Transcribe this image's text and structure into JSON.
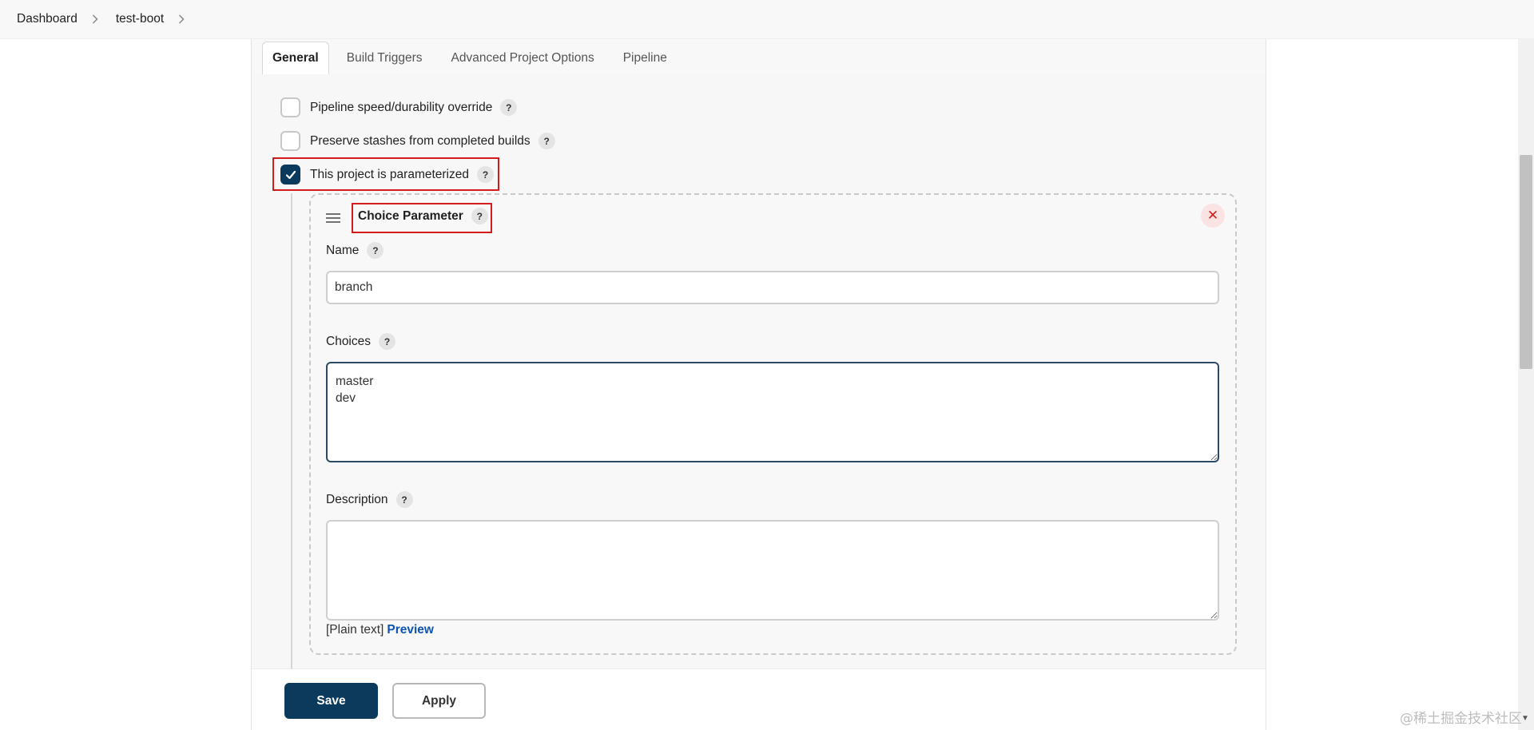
{
  "breadcrumb": {
    "items": [
      "Dashboard",
      "test-boot"
    ]
  },
  "tabs": [
    "General",
    "Build Triggers",
    "Advanced Project Options",
    "Pipeline"
  ],
  "options": {
    "pipeline_speed": "Pipeline speed/durability override",
    "preserve_stashes": "Preserve stashes from completed builds",
    "parameterized": "This project is parameterized"
  },
  "parameter": {
    "title": "Choice Parameter",
    "name_label": "Name",
    "name_value": "branch",
    "choices_label": "Choices",
    "choices_value": "master\ndev",
    "description_label": "Description",
    "description_value": "",
    "plain_text": "[Plain text]",
    "preview_link": "Preview"
  },
  "help_glyph": "?",
  "delete_glyph": "✕",
  "buttons": {
    "save": "Save",
    "apply": "Apply"
  },
  "watermark": "@稀土掘金技术社区",
  "colors": {
    "accent": "#0b3a5c",
    "highlight": "#d21d1d",
    "link": "#0b54b3"
  }
}
